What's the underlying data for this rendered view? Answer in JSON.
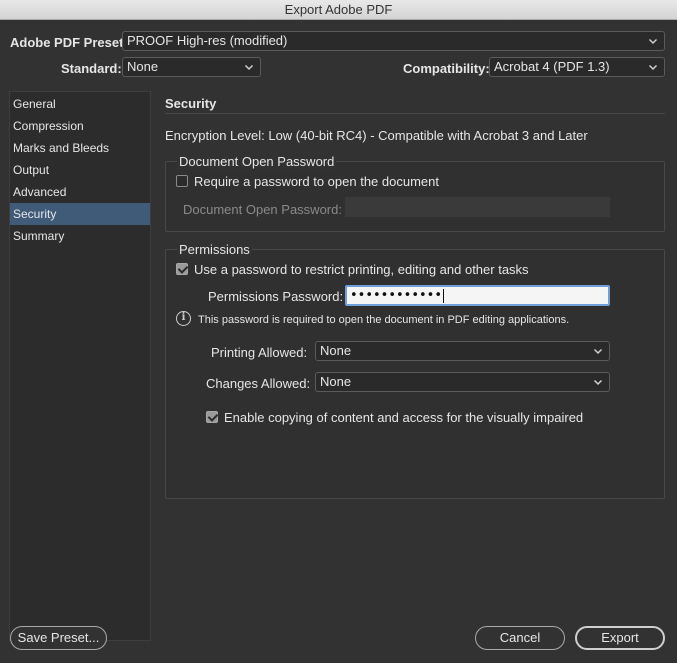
{
  "window": {
    "title": "Export Adobe PDF"
  },
  "preset": {
    "label": "Adobe PDF Preset:",
    "value": "PROOF High-res (modified)"
  },
  "standard": {
    "label": "Standard:",
    "value": "None"
  },
  "compatibility": {
    "label": "Compatibility:",
    "value": "Acrobat 4 (PDF 1.3)"
  },
  "sidebar": {
    "items": [
      {
        "label": "General"
      },
      {
        "label": "Compression"
      },
      {
        "label": "Marks and Bleeds"
      },
      {
        "label": "Output"
      },
      {
        "label": "Advanced"
      },
      {
        "label": "Security",
        "active": true
      },
      {
        "label": "Summary"
      }
    ]
  },
  "security": {
    "title": "Security",
    "encryption_level": "Encryption Level: Low (40-bit RC4) - Compatible with Acrobat 3 and Later",
    "doc_open": {
      "group_title": "Document Open Password",
      "require_label": "Require a password to open the document",
      "require_checked": false,
      "password_label": "Document Open Password:"
    },
    "permissions": {
      "group_title": "Permissions",
      "use_password_label": "Use a password to restrict printing, editing and other tasks",
      "use_password_checked": true,
      "password_label": "Permissions Password:",
      "password_value": "••••••••••••",
      "info_text": "This password is required to open the document in PDF editing applications.",
      "printing_label": "Printing Allowed:",
      "printing_value": "None",
      "changes_label": "Changes Allowed:",
      "changes_value": "None",
      "copying_label": "Enable copying of content and access for the visually impaired",
      "copying_checked": true
    }
  },
  "buttons": {
    "save_preset": "Save Preset...",
    "cancel": "Cancel",
    "export": "Export"
  }
}
